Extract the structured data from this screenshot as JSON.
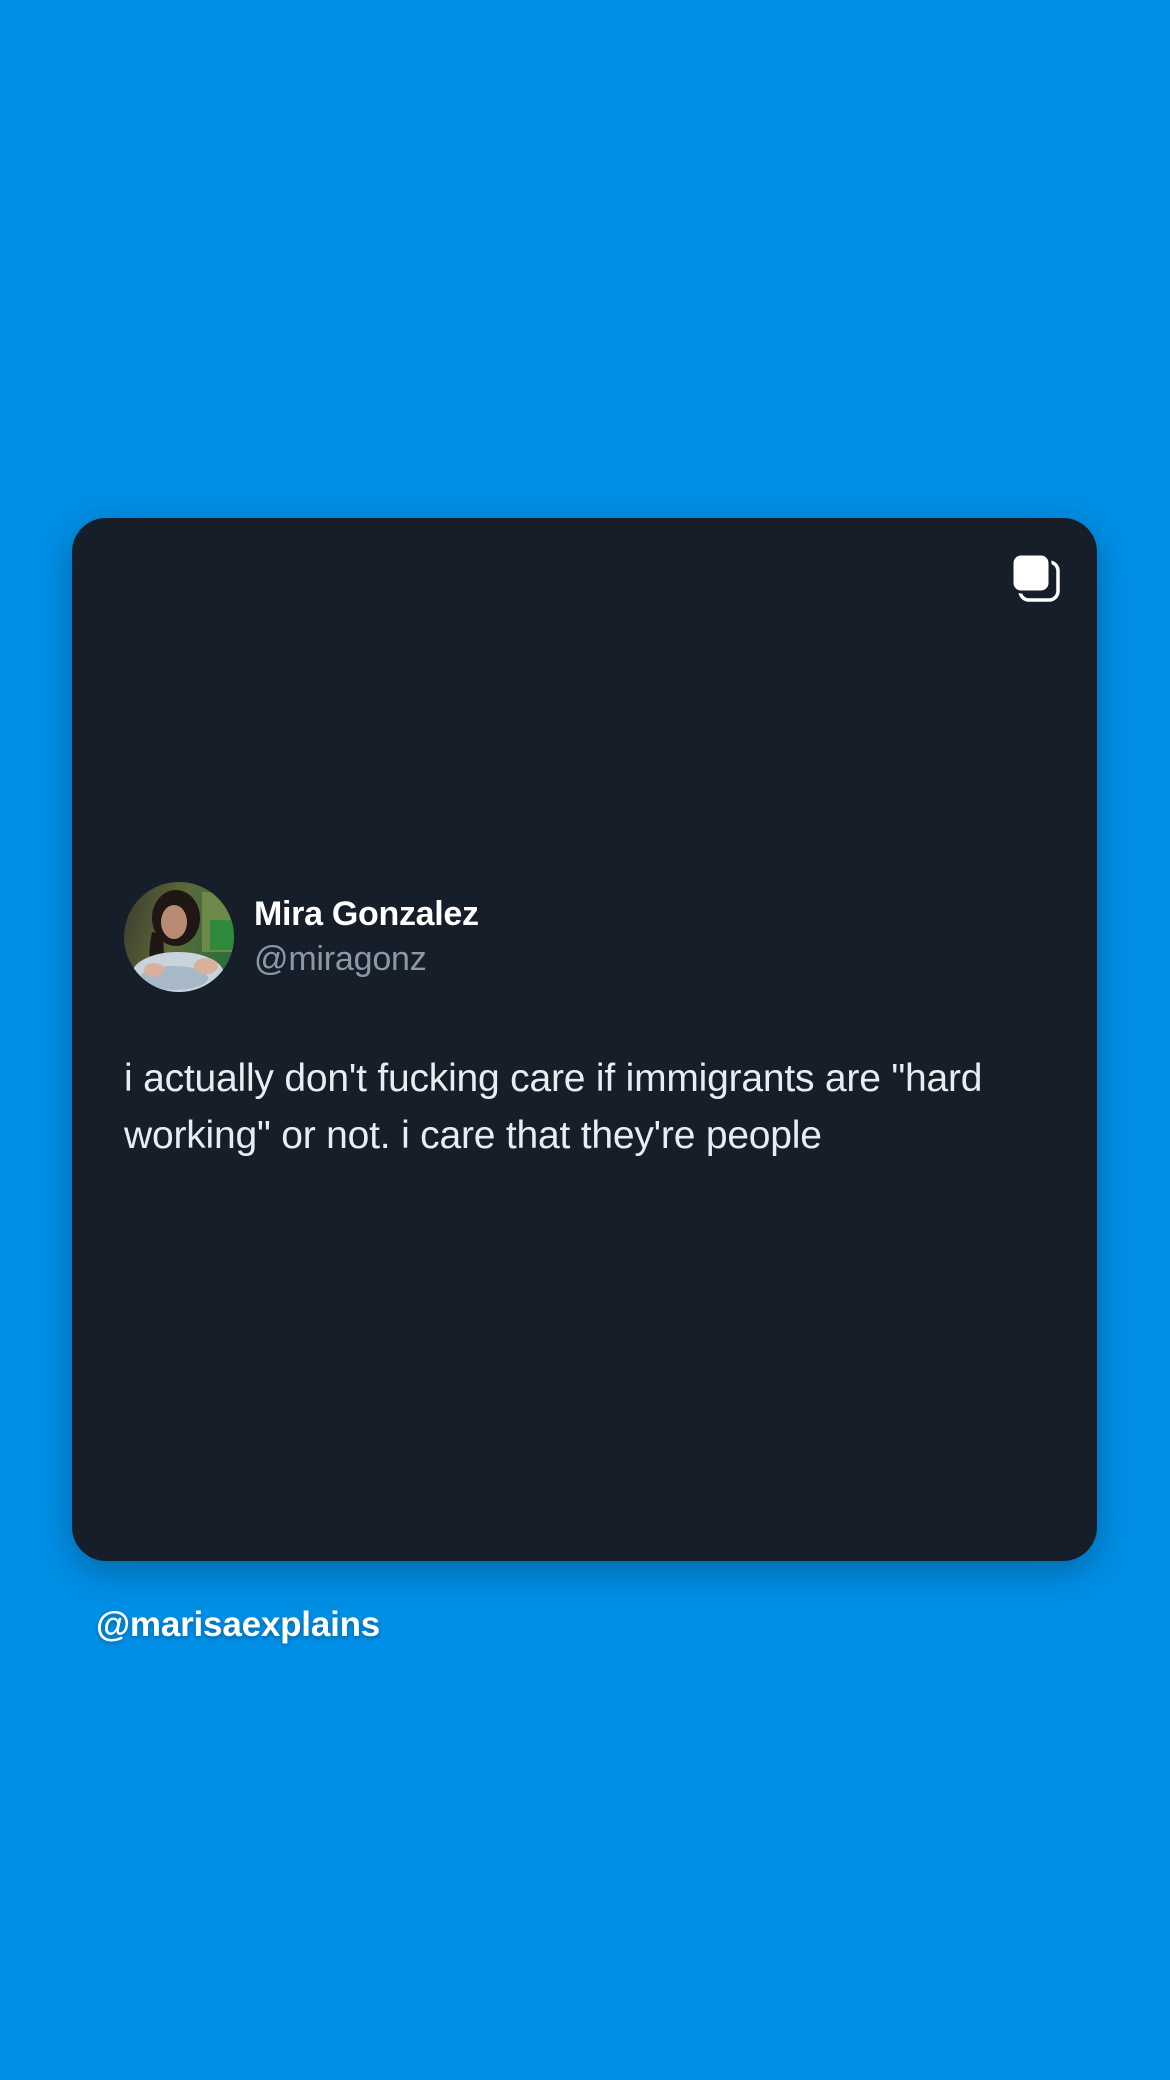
{
  "post": {
    "author_name": "Mira Gonzalez",
    "author_handle": "@miragonz",
    "text": "i actually don't fucking care if immigrants are \"hard working\" or not. i care that they're people",
    "corner_icon": "multiple-images-icon",
    "avatar_icon": "profile-photo"
  },
  "credit": {
    "handle": "@marisaexplains"
  },
  "colors": {
    "background": "#008FE6",
    "card": "#161E29",
    "name_text": "#FFFFFF",
    "handle_text": "#8D98A5",
    "body_text": "#E9EDF1"
  }
}
